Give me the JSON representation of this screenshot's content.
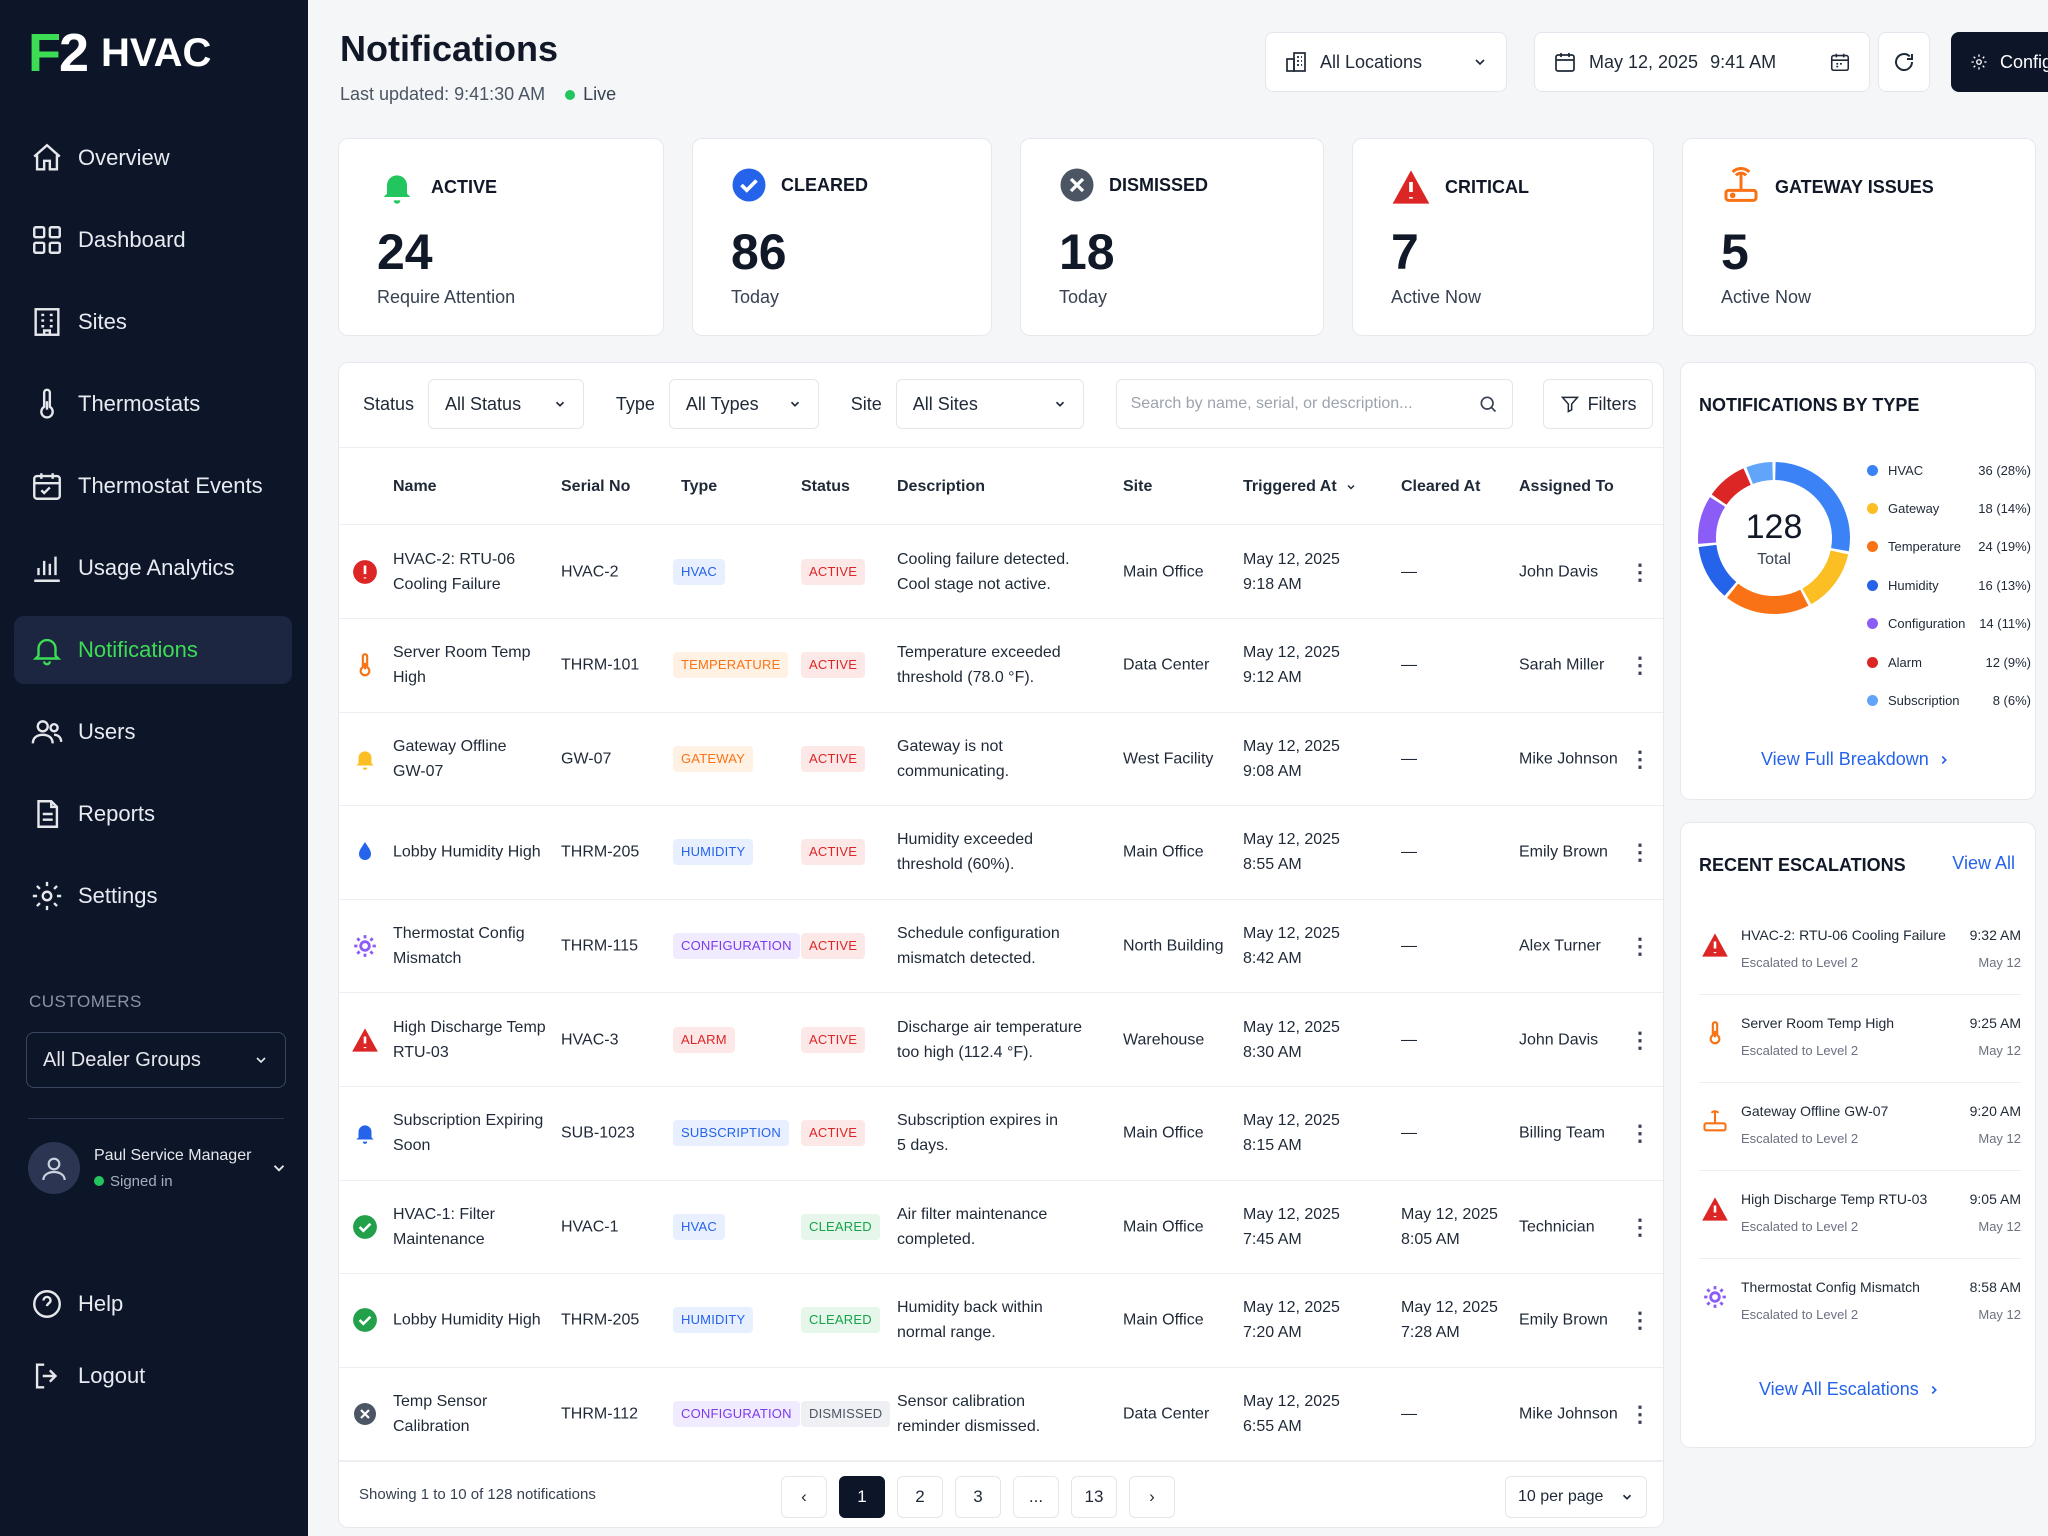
{
  "brand": {
    "mark_f": "F",
    "mark_2": "2",
    "name": "HVAC"
  },
  "nav": [
    {
      "label": "Overview",
      "icon": "home-icon"
    },
    {
      "label": "Dashboard",
      "icon": "grid-icon"
    },
    {
      "label": "Sites",
      "icon": "building-icon"
    },
    {
      "label": "Thermostats",
      "icon": "thermometer-icon"
    },
    {
      "label": "Thermostat Events",
      "icon": "calendar-icon"
    },
    {
      "label": "Usage Analytics",
      "icon": "bar-chart-icon"
    },
    {
      "label": "Notifications",
      "icon": "bell-icon",
      "active": true
    },
    {
      "label": "Users",
      "icon": "users-icon"
    },
    {
      "label": "Reports",
      "icon": "document-icon"
    },
    {
      "label": "Settings",
      "icon": "gear-icon"
    }
  ],
  "customers": {
    "title": "CUSTOMERS",
    "selected": "All Dealer Groups"
  },
  "user": {
    "name": "Paul Service Manager",
    "status": "Signed in"
  },
  "bottom_nav": [
    {
      "label": "Help"
    },
    {
      "label": "Logout"
    }
  ],
  "header": {
    "title": "Notifications",
    "updated": "Last updated: 9:41:30 AM",
    "live": "Live",
    "location": "All Locations",
    "date": "May 12, 2025",
    "time": "9:41 AM",
    "config": "Config"
  },
  "stats": [
    {
      "title": "ACTIVE",
      "value": "24",
      "sub": "Require Attention",
      "icon": "bell-icon",
      "color": "#22c55e"
    },
    {
      "title": "CLEARED",
      "value": "86",
      "sub": "Today",
      "icon": "check-circle-icon",
      "color": "#2563eb"
    },
    {
      "title": "DISMISSED",
      "value": "18",
      "sub": "Today",
      "icon": "x-circle-icon",
      "color": "#4b5563"
    },
    {
      "title": "CRITICAL",
      "value": "7",
      "sub": "Active Now",
      "icon": "warning-icon",
      "color": "#dc2626"
    },
    {
      "title": "GATEWAY ISSUES",
      "value": "5",
      "sub": "Active Now",
      "icon": "gateway-icon",
      "color": "#f97316"
    }
  ],
  "filters": {
    "status_label": "Status",
    "status_value": "All Status",
    "type_label": "Type",
    "type_value": "All Types",
    "site_label": "Site",
    "site_value": "All Sites",
    "search_placeholder": "Search by name, serial, or description...",
    "filters_button": "Filters"
  },
  "table": {
    "columns": [
      "Name",
      "Serial No",
      "Type",
      "Status",
      "Description",
      "Site",
      "Triggered At",
      "Cleared At",
      "Assigned To"
    ],
    "rows": [
      {
        "icon": "alert-circle-icon",
        "name1": "HVAC-2: RTU-06",
        "name2": "Cooling Failure",
        "serial": "HVAC-2",
        "type": "HVAC",
        "type_style": "blue",
        "status": "ACTIVE",
        "status_style": "red",
        "desc1": "Cooling failure detected.",
        "desc2": "Cool stage not active.",
        "site": "Main Office",
        "trig1": "May 12, 2025",
        "trig2": "9:18 AM",
        "cleared1": "—",
        "cleared2": "",
        "assigned": "John Davis"
      },
      {
        "icon": "thermometer-icon",
        "name1": "Server Room Temp",
        "name2": "High",
        "serial": "THRM-101",
        "type": "TEMPERATURE",
        "type_style": "orange",
        "status": "ACTIVE",
        "status_style": "red",
        "desc1": "Temperature exceeded",
        "desc2": "threshold (78.0 °F).",
        "site": "Data Center",
        "trig1": "May 12, 2025",
        "trig2": "9:12 AM",
        "cleared1": "—",
        "cleared2": "",
        "assigned": "Sarah Miller"
      },
      {
        "icon": "bell-icon",
        "name1": "Gateway Offline",
        "name2": "GW-07",
        "serial": "GW-07",
        "type": "GATEWAY",
        "type_style": "orange",
        "status": "ACTIVE",
        "status_style": "red",
        "desc1": "Gateway is not",
        "desc2": "communicating.",
        "site": "West Facility",
        "trig1": "May 12, 2025",
        "trig2": "9:08 AM",
        "cleared1": "—",
        "cleared2": "",
        "assigned": "Mike Johnson"
      },
      {
        "icon": "droplet-icon",
        "name1": "Lobby Humidity High",
        "name2": "",
        "serial": "THRM-205",
        "type": "HUMIDITY",
        "type_style": "blue",
        "status": "ACTIVE",
        "status_style": "red",
        "desc1": "Humidity exceeded",
        "desc2": "threshold (60%).",
        "site": "Main Office",
        "trig1": "May 12, 2025",
        "trig2": "8:55 AM",
        "cleared1": "—",
        "cleared2": "",
        "assigned": "Emily Brown"
      },
      {
        "icon": "gear-icon",
        "name1": "Thermostat Config",
        "name2": "Mismatch",
        "serial": "THRM-115",
        "type": "CONFIGURATION",
        "type_style": "purple",
        "status": "ACTIVE",
        "status_style": "red",
        "desc1": "Schedule configuration",
        "desc2": "mismatch detected.",
        "site": "North Building",
        "trig1": "May 12, 2025",
        "trig2": "8:42 AM",
        "cleared1": "—",
        "cleared2": "",
        "assigned": "Alex Turner"
      },
      {
        "icon": "warning-icon",
        "name1": "High Discharge Temp",
        "name2": "RTU-03",
        "serial": "HVAC-3",
        "type": "ALARM",
        "type_style": "red",
        "status": "ACTIVE",
        "status_style": "red",
        "desc1": "Discharge air temperature",
        "desc2": "too high (112.4 °F).",
        "site": "Warehouse",
        "trig1": "May 12, 2025",
        "trig2": "8:30 AM",
        "cleared1": "—",
        "cleared2": "",
        "assigned": "John Davis"
      },
      {
        "icon": "bell-icon",
        "name1": "Subscription Expiring",
        "name2": "Soon",
        "serial": "SUB-1023",
        "type": "SUBSCRIPTION",
        "type_style": "blue",
        "status": "ACTIVE",
        "status_style": "red",
        "desc1": "Subscription expires in",
        "desc2": "5 days.",
        "site": "Main Office",
        "trig1": "May 12, 2025",
        "trig2": "8:15 AM",
        "cleared1": "—",
        "cleared2": "",
        "assigned": "Billing Team"
      },
      {
        "icon": "check-circle-icon",
        "name1": "HVAC-1: Filter",
        "name2": "Maintenance",
        "serial": "HVAC-1",
        "type": "HVAC",
        "type_style": "blue",
        "status": "CLEARED",
        "status_style": "green",
        "desc1": "Air filter maintenance",
        "desc2": "completed.",
        "site": "Main Office",
        "trig1": "May 12, 2025",
        "trig2": "7:45 AM",
        "cleared1": "May 12, 2025",
        "cleared2": "8:05 AM",
        "assigned": "Technician"
      },
      {
        "icon": "check-circle-icon",
        "name1": "Lobby Humidity High",
        "name2": "",
        "serial": "THRM-205",
        "type": "HUMIDITY",
        "type_style": "blue",
        "status": "CLEARED",
        "status_style": "green",
        "desc1": "Humidity back within",
        "desc2": "normal range.",
        "site": "Main Office",
        "trig1": "May 12, 2025",
        "trig2": "7:20 AM",
        "cleared1": "May 12, 2025",
        "cleared2": "7:28 AM",
        "assigned": "Emily Brown"
      },
      {
        "icon": "x-circle-icon",
        "name1": "Temp Sensor",
        "name2": "Calibration",
        "serial": "THRM-112",
        "type": "CONFIGURATION",
        "type_style": "purple",
        "status": "DISMISSED",
        "status_style": "gray",
        "desc1": "Sensor calibration",
        "desc2": "reminder dismissed.",
        "site": "Data Center",
        "trig1": "May 12, 2025",
        "trig2": "6:55 AM",
        "cleared1": "—",
        "cleared2": "",
        "assigned": "Mike Johnson"
      }
    ]
  },
  "pagination": {
    "info": "Showing 1 to 10 of 128 notifications",
    "prev": "‹",
    "next": "›",
    "pages": [
      "1",
      "2",
      "3",
      "...",
      "13"
    ],
    "per_page": "10 per page"
  },
  "by_type": {
    "title": "NOTIFICATIONS BY TYPE",
    "total": "128",
    "total_label": "Total",
    "items": [
      {
        "name": "HVAC",
        "value": "36 (28%)",
        "count": 36,
        "color": "#3b82f6"
      },
      {
        "name": "Gateway",
        "value": "18 (14%)",
        "count": 18,
        "color": "#fbbf24"
      },
      {
        "name": "Temperature",
        "value": "24 (19%)",
        "count": 24,
        "color": "#f97316"
      },
      {
        "name": "Humidity",
        "value": "16 (13%)",
        "count": 16,
        "color": "#2563eb"
      },
      {
        "name": "Configuration",
        "value": "14 (11%)",
        "count": 14,
        "color": "#8b5cf6"
      },
      {
        "name": "Alarm",
        "value": "12 (9%)",
        "count": 12,
        "color": "#dc2626"
      },
      {
        "name": "Subscription",
        "value": "8 (6%)",
        "count": 8,
        "color": "#60a5fa"
      }
    ],
    "link": "View Full Breakdown"
  },
  "escalations": {
    "title": "RECENT ESCALATIONS",
    "view_all": "View All",
    "items": [
      {
        "icon": "warning-icon",
        "title": "HVAC-2: RTU-06 Cooling Failure",
        "sub": "Escalated to Level 2",
        "time": "9:32 AM",
        "date": "May 12"
      },
      {
        "icon": "thermometer-icon",
        "title": "Server Room Temp High",
        "sub": "Escalated to Level 2",
        "time": "9:25 AM",
        "date": "May 12"
      },
      {
        "icon": "gateway-icon",
        "title": "Gateway Offline GW-07",
        "sub": "Escalated to Level 2",
        "time": "9:20 AM",
        "date": "May 12"
      },
      {
        "icon": "warning-icon",
        "title": "High Discharge Temp RTU-03",
        "sub": "Escalated to Level 2",
        "time": "9:05 AM",
        "date": "May 12"
      },
      {
        "icon": "gear-icon",
        "title": "Thermostat Config Mismatch",
        "sub": "Escalated to Level 2",
        "time": "8:58 AM",
        "date": "May 12"
      }
    ],
    "link": "View All Escalations"
  }
}
